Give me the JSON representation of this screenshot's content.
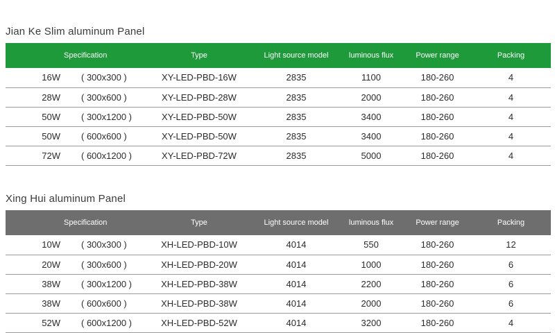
{
  "tables": [
    {
      "title": "Jian Ke Slim aluminum Panel",
      "headers": [
        "Specification",
        "Type",
        "Light source model",
        "luminous flux",
        "Power range",
        "Packing"
      ],
      "rows": [
        {
          "watt": "16W",
          "size": "( 300x300 )",
          "type": "XY-LED-PBD-16W",
          "source": "2835",
          "flux": "1100",
          "power": "180-260",
          "packing": "4"
        },
        {
          "watt": "28W",
          "size": "( 300x600 )",
          "type": "XY-LED-PBD-28W",
          "source": "2835",
          "flux": "2000",
          "power": "180-260",
          "packing": "4"
        },
        {
          "watt": "50W",
          "size": "( 300x1200 )",
          "type": "XY-LED-PBD-50W",
          "source": "2835",
          "flux": "3400",
          "power": "180-260",
          "packing": "4"
        },
        {
          "watt": "50W",
          "size": "( 600x600 )",
          "type": "XY-LED-PBD-50W",
          "source": "2835",
          "flux": "3400",
          "power": "180-260",
          "packing": "4"
        },
        {
          "watt": "72W",
          "size": "( 600x1200 )",
          "type": "XY-LED-PBD-72W",
          "source": "2835",
          "flux": "5000",
          "power": "180-260",
          "packing": "4"
        }
      ]
    },
    {
      "title": "Xing Hui aluminum Panel",
      "headers": [
        "Specification",
        "Type",
        "Light source model",
        "luminous flux",
        "Power range",
        "Packing"
      ],
      "rows": [
        {
          "watt": "10W",
          "size": "( 300x300 )",
          "type": "XH-LED-PBD-10W",
          "source": "4014",
          "flux": "550",
          "power": "180-260",
          "packing": "12"
        },
        {
          "watt": "20W",
          "size": "( 300x600 )",
          "type": "XH-LED-PBD-20W",
          "source": "4014",
          "flux": "1000",
          "power": "180-260",
          "packing": "6"
        },
        {
          "watt": "38W",
          "size": "( 300x1200 )",
          "type": "XH-LED-PBD-38W",
          "source": "4014",
          "flux": "2200",
          "power": "180-260",
          "packing": "6"
        },
        {
          "watt": "38W",
          "size": "( 600x600 )",
          "type": "XH-LED-PBD-38W",
          "source": "4014",
          "flux": "2000",
          "power": "180-260",
          "packing": "6"
        },
        {
          "watt": "52W",
          "size": "( 600x1200 )",
          "type": "XH-LED-PBD-52W",
          "source": "4014",
          "flux": "3200",
          "power": "180-260",
          "packing": "4"
        }
      ]
    }
  ],
  "colors": {
    "header_green": "#1f9a3a",
    "header_gray": "#6e6e6e",
    "row_line": "#9a9a9a"
  }
}
